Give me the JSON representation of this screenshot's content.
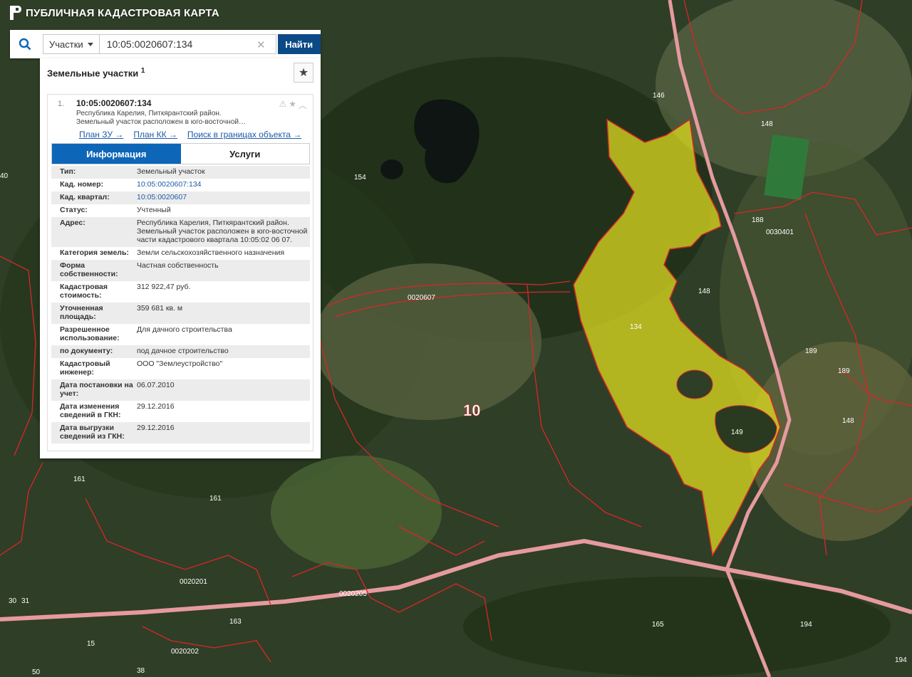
{
  "app": {
    "title": "ПУБЛИЧНАЯ КАДАСТРОВАЯ КАРТА"
  },
  "search": {
    "type_label": "Участки",
    "value": "10:05:0020607:134",
    "find_label": "Найти"
  },
  "panel": {
    "title": "Земельные участки",
    "count": "1",
    "result": {
      "index": "1.",
      "cad_number": "10:05:0020607:134",
      "address_line1": "Республика Карелия, Питкярантский район.",
      "address_line2": "Земельный участок расположен в юго-восточной…",
      "links": [
        "План ЗУ →",
        "План КК →",
        "Поиск в границах объекта →"
      ]
    },
    "tabs": [
      "Информация",
      "Услуги"
    ],
    "info_rows": [
      {
        "key": "Тип:",
        "value": "Земельный участок"
      },
      {
        "key": "Кад. номер:",
        "value": "10:05:0020607:134"
      },
      {
        "key": "Кад. квартал:",
        "value": "10:05:0020607"
      },
      {
        "key": "Статус:",
        "value": "Учтенный"
      },
      {
        "key": "Адрес:",
        "value": "Республика Карелия, Питкярантский район. Земельный участок расположен в юго-восточной части кадастрового квартала 10:05:02 06 07."
      },
      {
        "key": "Категория земель:",
        "value": "Земли сельскохозяйственного назначения"
      },
      {
        "key": "Форма собственности:",
        "value": "Частная собственность"
      },
      {
        "key": "Кадастровая стоимость:",
        "value": "312 922,47 руб."
      },
      {
        "key": "Уточненная площадь:",
        "value": "359 681 кв. м"
      },
      {
        "key": "Разрешенное использование:",
        "value": "Для дачного строительства"
      },
      {
        "key": "по документу:",
        "value": "под дачное строительство"
      },
      {
        "key": "Кадастровый инженер:",
        "value": "ООО \"Землеустройство\""
      },
      {
        "key": "Дата постановки на учет:",
        "value": "06.07.2010"
      },
      {
        "key": "Дата изменения сведений в ГКН:",
        "value": "29.12.2016"
      },
      {
        "key": "Дата выгрузки сведений из ГКН:",
        "value": "29.12.2016"
      }
    ]
  },
  "map": {
    "parcel_labels": [
      "146",
      "148",
      "154",
      "188",
      "148",
      "134",
      "189",
      "189",
      "148",
      "149",
      "161",
      "161",
      "163",
      "165",
      "194",
      "194",
      "15",
      "30",
      "31",
      "38",
      "50",
      "40"
    ],
    "quarter_labels": [
      "0030401",
      "0020607",
      "0020201",
      "0020205",
      "0020202"
    ],
    "district_label": "10",
    "selected_parcel_label": "134",
    "colors": {
      "parcel_fill": "#e4e21f",
      "boundary": "#d8262a",
      "road": "#e69aa0"
    }
  }
}
